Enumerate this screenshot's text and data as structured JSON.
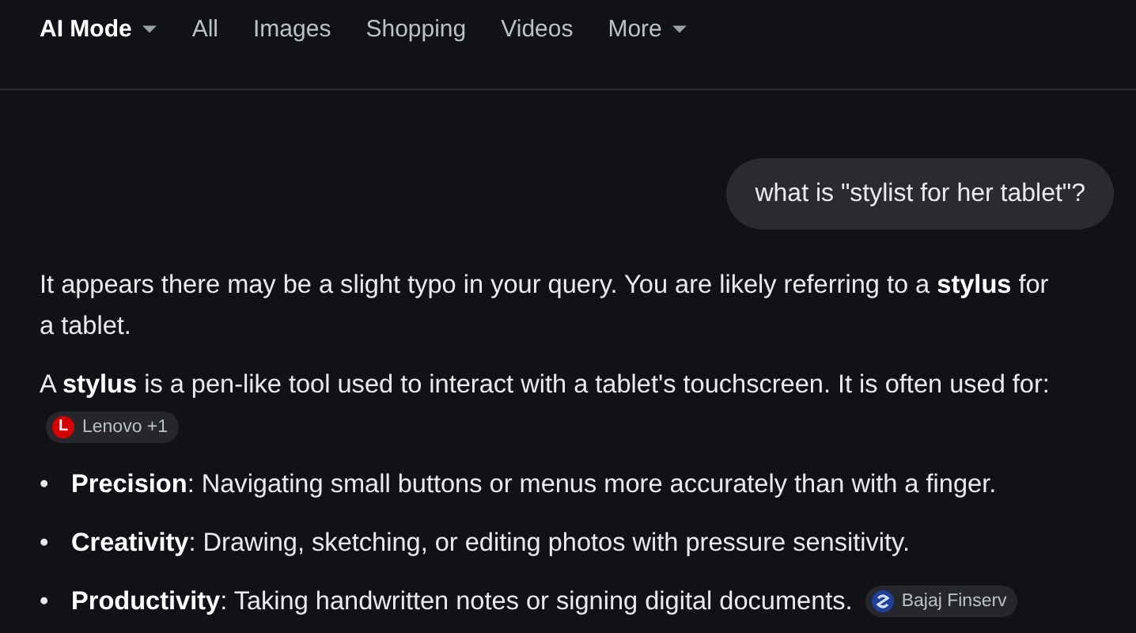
{
  "tabs": [
    {
      "label": "AI Mode",
      "selected": true,
      "dropdown": true
    },
    {
      "label": "All",
      "selected": false,
      "dropdown": false
    },
    {
      "label": "Images",
      "selected": false,
      "dropdown": false
    },
    {
      "label": "Shopping",
      "selected": false,
      "dropdown": false
    },
    {
      "label": "Videos",
      "selected": false,
      "dropdown": false
    },
    {
      "label": "More",
      "selected": false,
      "dropdown": true
    }
  ],
  "query": "what is \"stylist for her tablet\"?",
  "answer": [
    {
      "kind": "paragraph",
      "text": "It appears there may be a slight typo in your query. You are likely referring to a **stylus** for a tablet."
    },
    {
      "kind": "paragraph",
      "text": "A **stylus** is a pen-like tool used to interact with a tablet's touchscreen. It is often used for:",
      "source": {
        "kind": "letter",
        "logo_text": "L",
        "label": "Lenovo +1"
      }
    },
    {
      "kind": "bullet",
      "marker": "•",
      "text": "**Precision**: Navigating small buttons or menus more accurately than with a finger."
    },
    {
      "kind": "bullet",
      "marker": "•",
      "text": "**Creativity**: Drawing, sketching, or editing photos with pressure sensitivity."
    },
    {
      "kind": "bullet",
      "marker": "•",
      "text": "**Productivity**: Taking handwritten notes or signing digital documents.",
      "source": {
        "kind": "emblem",
        "label": "Bajaj Finserv"
      }
    }
  ]
}
